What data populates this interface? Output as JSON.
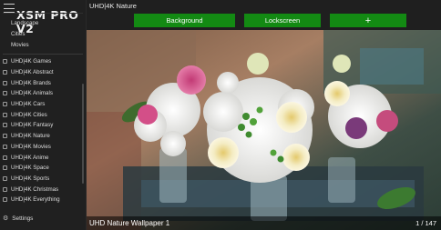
{
  "sidebar": {
    "title": "XSM PRO V2",
    "top_items": [
      "Landscape",
      "Cities",
      "Movies"
    ],
    "items": [
      "UHD|4K Games",
      "UHD|4K Abstract",
      "UHD|4K Brands",
      "UHD|4K Animals",
      "UHD|4K Cars",
      "UHD|4K Cities",
      "UHD|4K Fantasy",
      "UHD|4K Nature",
      "UHD|4K Movies",
      "UHD|4K Anime",
      "UHD|4K Space",
      "UHD|4K Sports",
      "UHD|4K Christmas",
      "UHD|4K Everything"
    ],
    "settings_label": "Settings"
  },
  "main": {
    "title": "UHD|4K Nature",
    "buttons": {
      "background": "Background",
      "lockscreen": "Lockscreen",
      "add": "+"
    },
    "caption": "UHD Nature Wallpaper 1",
    "counter": "1 / 147"
  },
  "colors": {
    "accent": "#138a13",
    "background": "#1f1f1f"
  }
}
